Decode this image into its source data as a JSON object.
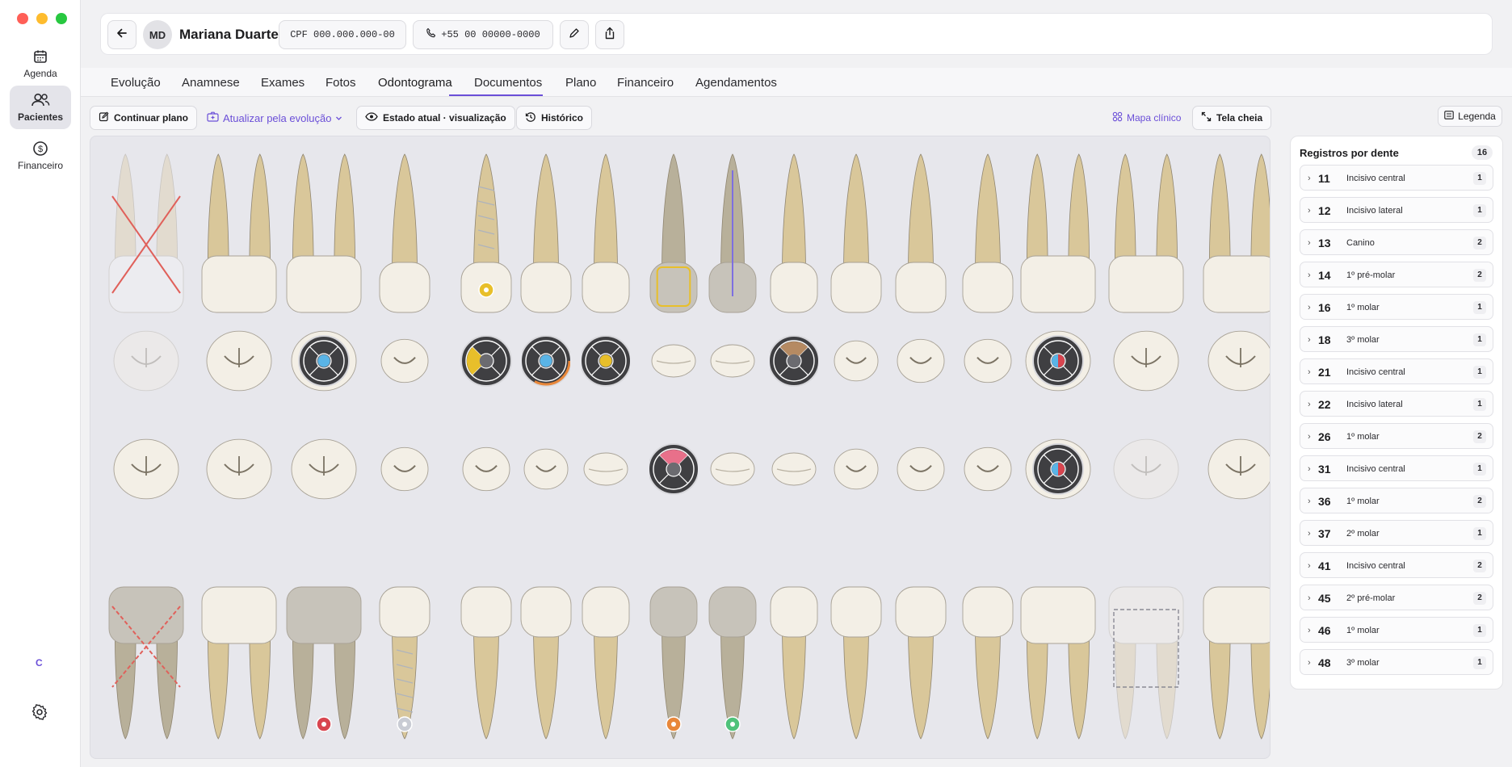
{
  "nav": {
    "items": [
      {
        "label": "Agenda",
        "icon": "calendar-icon"
      },
      {
        "label": "Pacientes",
        "icon": "users-icon"
      },
      {
        "label": "Financeiro",
        "icon": "dollar-circle-icon"
      }
    ],
    "user_initial": "C"
  },
  "header": {
    "initials": "MD",
    "name": "Mariana Duarte",
    "cpf": "CPF 000.000.000-00",
    "phone": "+55 00 00000-0000"
  },
  "tabs": [
    "Evolução",
    "Anamnese",
    "Exames",
    "Fotos",
    "Odontograma",
    "Documentos",
    "Plano",
    "Financeiro",
    "Agendamentos"
  ],
  "active_tab": "Odontograma",
  "toolbar": {
    "continue_plan": "Continuar plano",
    "update_from_evolution": "Atualizar pela evolução",
    "current_state": "Estado atual · visualização",
    "history": "Histórico",
    "clinical_map": "Mapa clínico",
    "fullscreen": "Tela cheia",
    "legend": "Legenda"
  },
  "records": {
    "title": "Registros por dente",
    "total": "16",
    "items": [
      {
        "tooth": "11",
        "name": "Incisivo central",
        "count": "1"
      },
      {
        "tooth": "12",
        "name": "Incisivo lateral",
        "count": "1"
      },
      {
        "tooth": "13",
        "name": "Canino",
        "count": "2"
      },
      {
        "tooth": "14",
        "name": "1º pré-molar",
        "count": "2"
      },
      {
        "tooth": "16",
        "name": "1º molar",
        "count": "1"
      },
      {
        "tooth": "18",
        "name": "3º molar",
        "count": "1"
      },
      {
        "tooth": "21",
        "name": "Incisivo central",
        "count": "1"
      },
      {
        "tooth": "22",
        "name": "Incisivo lateral",
        "count": "1"
      },
      {
        "tooth": "26",
        "name": "1º molar",
        "count": "2"
      },
      {
        "tooth": "31",
        "name": "Incisivo central",
        "count": "1"
      },
      {
        "tooth": "36",
        "name": "1º molar",
        "count": "2"
      },
      {
        "tooth": "37",
        "name": "2º molar",
        "count": "1"
      },
      {
        "tooth": "41",
        "name": "Incisivo central",
        "count": "2"
      },
      {
        "tooth": "45",
        "name": "2º pré-molar",
        "count": "2"
      },
      {
        "tooth": "46",
        "name": "1º molar",
        "count": "1"
      },
      {
        "tooth": "48",
        "name": "3º molar",
        "count": "1"
      }
    ]
  },
  "colors": {
    "accent": "#6b4fd8",
    "enamel": "#f3efe6",
    "root": "#d9c79a",
    "missing_mark": "#e0605a",
    "marker_blue": "#5ab4e6",
    "marker_yellow": "#e8bf2a",
    "marker_pink": "#e8708a",
    "marker_red": "#d8454f",
    "marker_orange": "#e8873a",
    "marker_green": "#4fc27a"
  },
  "odontogram": {
    "upper": [
      {
        "kind": "molar",
        "state": "missing"
      },
      {
        "kind": "molar",
        "state": "normal"
      },
      {
        "kind": "molar",
        "state": "crown"
      },
      {
        "kind": "premolar",
        "state": "normal"
      },
      {
        "kind": "premolar",
        "state": "implant",
        "badge": "yellow"
      },
      {
        "kind": "canine",
        "state": "normal"
      },
      {
        "kind": "incisor",
        "state": "normal"
      },
      {
        "kind": "incisor",
        "state": "veneer"
      },
      {
        "kind": "incisor",
        "state": "root-canal"
      },
      {
        "kind": "incisor",
        "state": "normal"
      },
      {
        "kind": "canine",
        "state": "normal"
      },
      {
        "kind": "premolar",
        "state": "normal"
      },
      {
        "kind": "premolar",
        "state": "normal"
      },
      {
        "kind": "molar",
        "state": "crown"
      },
      {
        "kind": "molar",
        "state": "normal"
      },
      {
        "kind": "molar",
        "state": "normal"
      }
    ],
    "upper_occlusal": [
      {
        "kind": "molar",
        "faded": true
      },
      {
        "kind": "molar"
      },
      {
        "kind": "molar",
        "marker": [
          "blue"
        ]
      },
      {
        "kind": "premolar"
      },
      {
        "kind": "premolar",
        "marker": [
          "yellow"
        ]
      },
      {
        "kind": "canine",
        "marker": [
          "blue",
          "orange"
        ]
      },
      {
        "kind": "incisor",
        "marker": [
          "yellow"
        ]
      },
      {
        "kind": "incisor"
      },
      {
        "kind": "incisor"
      },
      {
        "kind": "incisor",
        "marker": [
          "brown"
        ]
      },
      {
        "kind": "canine"
      },
      {
        "kind": "premolar"
      },
      {
        "kind": "premolar"
      },
      {
        "kind": "molar",
        "marker": [
          "split"
        ]
      },
      {
        "kind": "molar"
      },
      {
        "kind": "molar"
      }
    ],
    "lower_occlusal": [
      {
        "kind": "molar"
      },
      {
        "kind": "molar"
      },
      {
        "kind": "molar"
      },
      {
        "kind": "premolar"
      },
      {
        "kind": "premolar"
      },
      {
        "kind": "canine"
      },
      {
        "kind": "incisor"
      },
      {
        "kind": "incisor",
        "marker": [
          "pink"
        ]
      },
      {
        "kind": "incisor"
      },
      {
        "kind": "incisor"
      },
      {
        "kind": "canine"
      },
      {
        "kind": "premolar"
      },
      {
        "kind": "premolar"
      },
      {
        "kind": "molar",
        "marker": [
          "split"
        ]
      },
      {
        "kind": "molar",
        "faded": true
      },
      {
        "kind": "molar"
      }
    ],
    "lower": [
      {
        "kind": "molar",
        "state": "missing-grey"
      },
      {
        "kind": "molar",
        "state": "normal"
      },
      {
        "kind": "molar",
        "state": "grey",
        "badge": "red"
      },
      {
        "kind": "premolar",
        "state": "implant",
        "badge": "silver"
      },
      {
        "kind": "premolar",
        "state": "normal"
      },
      {
        "kind": "canine",
        "state": "normal"
      },
      {
        "kind": "incisor",
        "state": "normal"
      },
      {
        "kind": "incisor",
        "state": "grey",
        "badge": "orange"
      },
      {
        "kind": "incisor",
        "state": "grey",
        "badge": "green"
      },
      {
        "kind": "incisor",
        "state": "normal"
      },
      {
        "kind": "canine",
        "state": "normal"
      },
      {
        "kind": "premolar",
        "state": "normal"
      },
      {
        "kind": "premolar",
        "state": "normal"
      },
      {
        "kind": "molar",
        "state": "normal"
      },
      {
        "kind": "molar",
        "state": "extracted"
      },
      {
        "kind": "molar",
        "state": "normal"
      }
    ]
  }
}
